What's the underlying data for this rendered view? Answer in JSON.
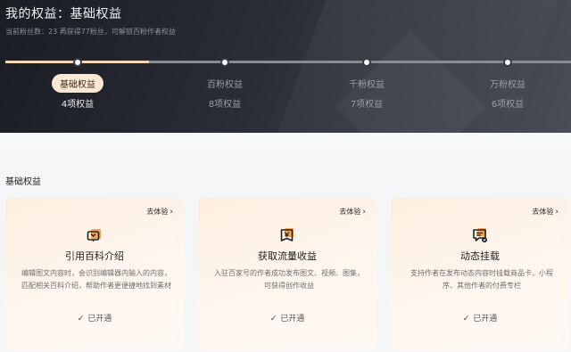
{
  "header": {
    "title": "我的权益：基础权益",
    "subtitle": "当前粉丝数：23   再获得77粉丝，可解锁百粉作者权益"
  },
  "progress": {
    "fill_fraction": 0.25
  },
  "tiers": [
    {
      "name": "基础权益",
      "count": "4项权益",
      "active": true
    },
    {
      "name": "百粉权益",
      "count": "8项权益",
      "active": false
    },
    {
      "name": "千粉权益",
      "count": "7项权益",
      "active": false
    },
    {
      "name": "万粉权益",
      "count": "6项权益",
      "active": false
    }
  ],
  "section": {
    "title": "基础权益"
  },
  "cards": [
    {
      "icon": "reference-icon",
      "try_label": "去体验",
      "title": "引用百科介绍",
      "description": "编辑图文内容时，会识别编辑器内输入的内容，匹配相关百科介绍，帮助作者更便捷地找到素材",
      "status": "已开通"
    },
    {
      "icon": "income-icon",
      "try_label": "去体验",
      "title": "获取流量收益",
      "description": "入驻百家号的作者成功发布图文、视频、图集，可获得创作收益",
      "status": "已开通"
    },
    {
      "icon": "mount-icon",
      "try_label": "去体验",
      "title": "动态挂载",
      "description": "支持作者在发布动态内容时挂载商品卡、小程序、其他作者的付费专栏",
      "status": "已开通"
    }
  ],
  "colors": {
    "accent": "#f5d6b6",
    "icon_orange": "#f59a3a",
    "header_bg": "#23252d"
  }
}
